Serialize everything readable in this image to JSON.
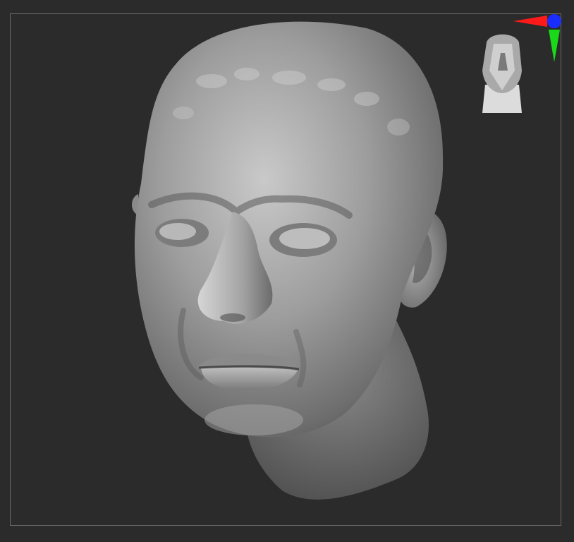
{
  "viewport": {
    "background_color": "#2b2b2b",
    "frame_color": "#6a6a6a",
    "model_name": "sculpted-male-head",
    "model_material_color": "#8f8f8f"
  },
  "navigation": {
    "head_icon": "nav-head-icon",
    "axis_colors": {
      "x": "#ff1a1a",
      "y": "#19d919",
      "z": "#1a2dff"
    }
  }
}
